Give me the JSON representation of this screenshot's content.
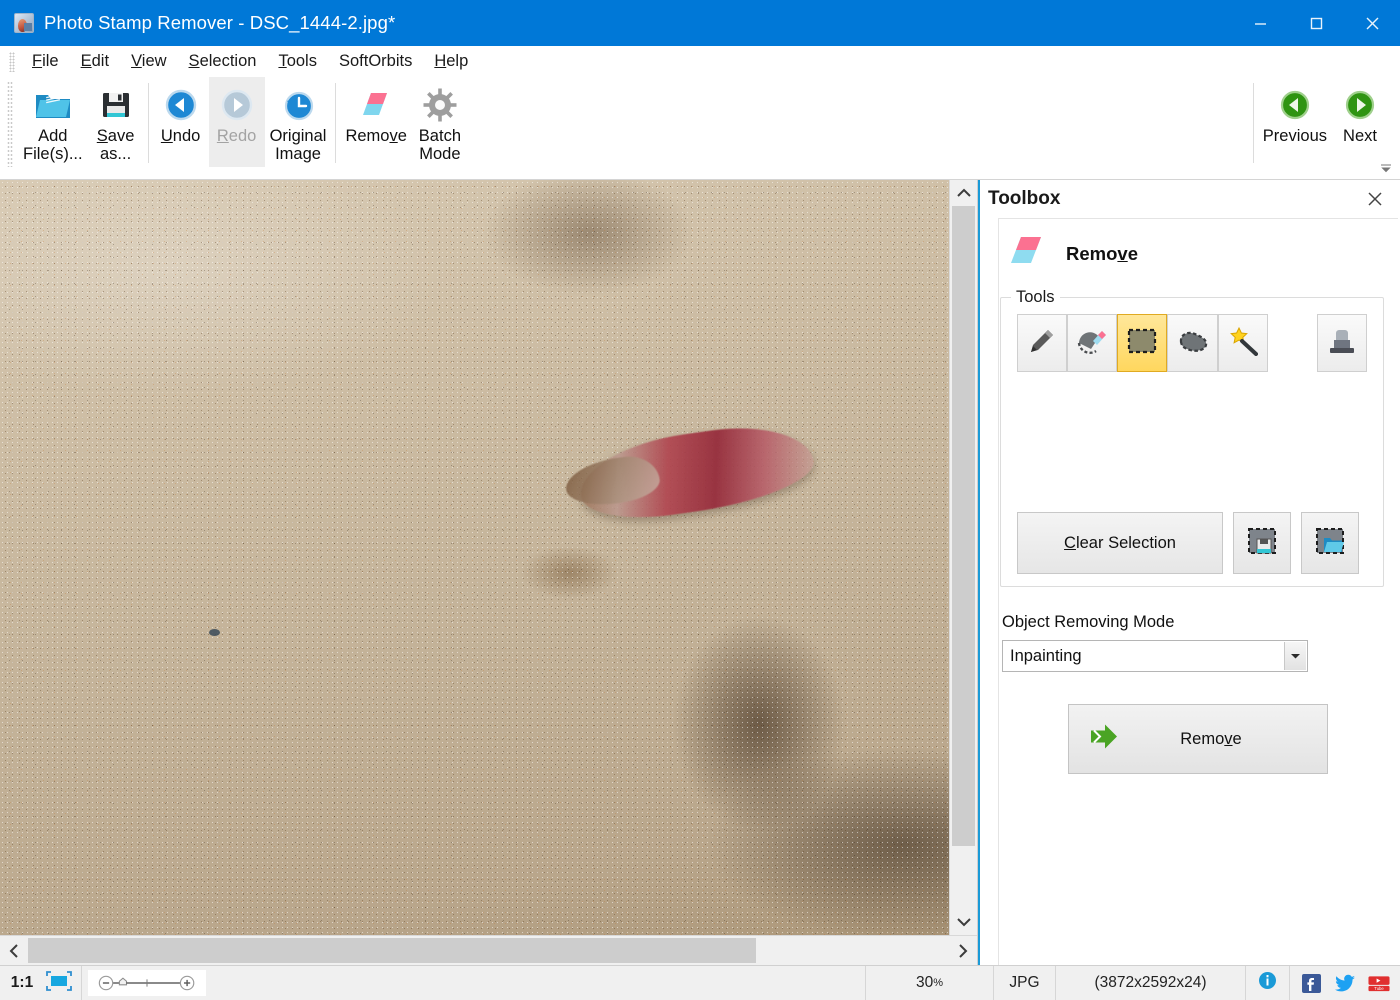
{
  "window": {
    "title": "Photo Stamp Remover - DSC_1444-2.jpg*",
    "app_icon": "photo-app-icon",
    "minimize_label": "Minimize",
    "maximize_label": "Maximize",
    "close_label": "Close"
  },
  "menubar": {
    "items": [
      {
        "label": "File",
        "accel": "F"
      },
      {
        "label": "Edit",
        "accel": "E"
      },
      {
        "label": "View",
        "accel": "V"
      },
      {
        "label": "Selection",
        "accel": "S"
      },
      {
        "label": "Tools",
        "accel": "T"
      },
      {
        "label": "SoftOrbits",
        "accel": ""
      },
      {
        "label": "Help",
        "accel": "H"
      }
    ]
  },
  "toolbar": {
    "buttons": [
      {
        "label": "Add\nFile(s)...",
        "icon": "open-folder-icon",
        "state": "enabled"
      },
      {
        "label": "Save\nas...",
        "icon": "floppy-save-icon",
        "state": "enabled"
      },
      {
        "label": "Undo",
        "icon": "undo-arrow-icon",
        "state": "enabled"
      },
      {
        "label": "Redo",
        "icon": "redo-arrow-icon",
        "state": "disabled"
      },
      {
        "label": "Original\nImage",
        "icon": "history-clock-icon",
        "state": "enabled"
      },
      {
        "label": "Remove",
        "icon": "eraser-icon",
        "state": "enabled"
      },
      {
        "label": "Batch\nMode",
        "icon": "gear-icon",
        "state": "enabled"
      }
    ],
    "nav": [
      {
        "label": "Previous",
        "icon": "green-left-arrow-icon"
      },
      {
        "label": "Next",
        "icon": "green-right-arrow-icon"
      }
    ],
    "overflow_icon": "toolbar-overflow-icon"
  },
  "toolbox": {
    "panel_title": "Toolbox",
    "close_icon": "close-icon",
    "section_title": "Remove",
    "section_icon": "eraser-icon",
    "tools_group_legend": "Tools",
    "tools": [
      {
        "name": "pencil",
        "icon": "pencil-icon",
        "active": false
      },
      {
        "name": "eraser-selection",
        "icon": "eraser-selection-icon",
        "active": false
      },
      {
        "name": "rectangle-marquee",
        "icon": "rectangle-marquee-icon",
        "active": true
      },
      {
        "name": "lasso",
        "icon": "lasso-icon",
        "active": false
      },
      {
        "name": "magic-wand",
        "icon": "magic-wand-icon",
        "active": false
      },
      {
        "name": "stamp",
        "icon": "clone-stamp-icon",
        "active": false
      }
    ],
    "clear_selection_label": "Clear Selection",
    "clear_selection_accel": "C",
    "save_selection_icon": "save-selection-icon",
    "load_selection_icon": "load-selection-icon",
    "mode_label": "Object Removing Mode",
    "mode_value": "Inpainting",
    "mode_options": [
      "Inpainting"
    ],
    "mode_arrow_icon": "chevron-down-icon",
    "remove_button_label": "Remove",
    "remove_button_icon": "green-double-arrow-icon"
  },
  "canvas": {
    "scroll_up_icon": "chevron-up-icon",
    "scroll_down_icon": "chevron-down-icon",
    "scroll_left_icon": "chevron-left-icon",
    "scroll_right_icon": "chevron-right-icon"
  },
  "statusbar": {
    "zoom_ratio": "1:1",
    "fit_icon": "fit-to-window-icon",
    "zoom_out_icon": "zoom-out-icon",
    "zoom_in_icon": "zoom-in-icon",
    "zoom_handle_icon": "slider-handle-icon",
    "zoom_percent": "30",
    "zoom_percent_suffix": "%",
    "file_format": "JPG",
    "dimensions": "(3872x2592x24)",
    "info_icon": "info-icon",
    "social": [
      {
        "name": "facebook-icon",
        "label": "f"
      },
      {
        "name": "twitter-icon",
        "label": "t"
      },
      {
        "name": "youtube-icon",
        "label": "You"
      }
    ]
  },
  "colors": {
    "titlebar": "#0078d7",
    "accent_panel_border": "#1a9ad7",
    "active_tool": "#ffd75e",
    "nav_green": "#3a9e1e",
    "info_blue": "#1a9ad7"
  }
}
